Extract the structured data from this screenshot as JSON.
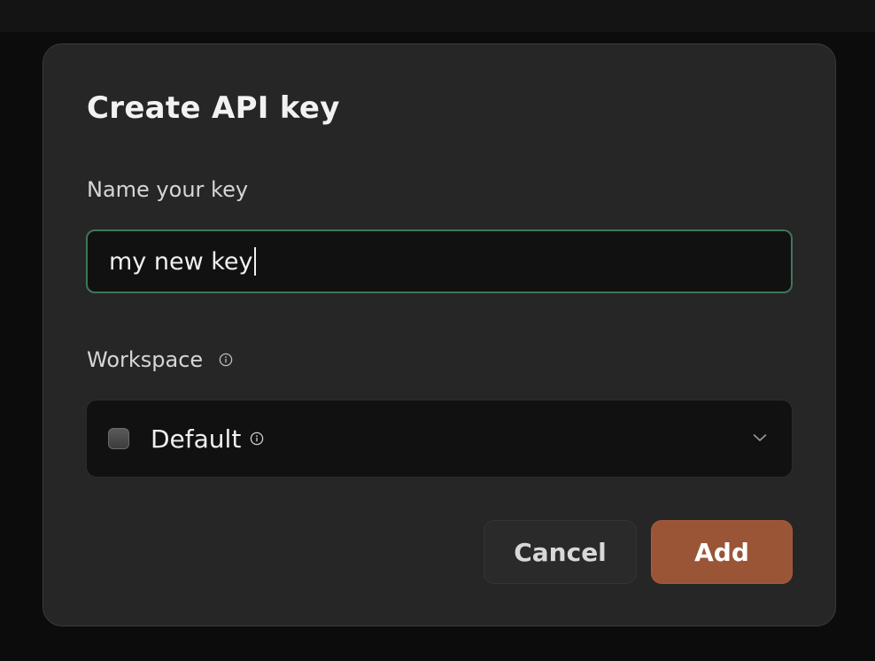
{
  "dialog": {
    "title": "Create API key",
    "name_field": {
      "label": "Name your key",
      "value": "my new key"
    },
    "workspace_field": {
      "label": "Workspace",
      "selected": "Default"
    },
    "buttons": {
      "cancel": "Cancel",
      "add": "Add"
    }
  },
  "colors": {
    "background": "#0c0c0c",
    "modal": "#262626",
    "input_bg": "#111111",
    "input_focus_border": "#3f7656",
    "add_button": "#9a5536"
  },
  "icons": {
    "label_info": "info-circle-icon",
    "value_info": "info-circle-icon",
    "dropdown": "chevron-down-icon",
    "workspace_swatch": "square-swatch-icon"
  }
}
